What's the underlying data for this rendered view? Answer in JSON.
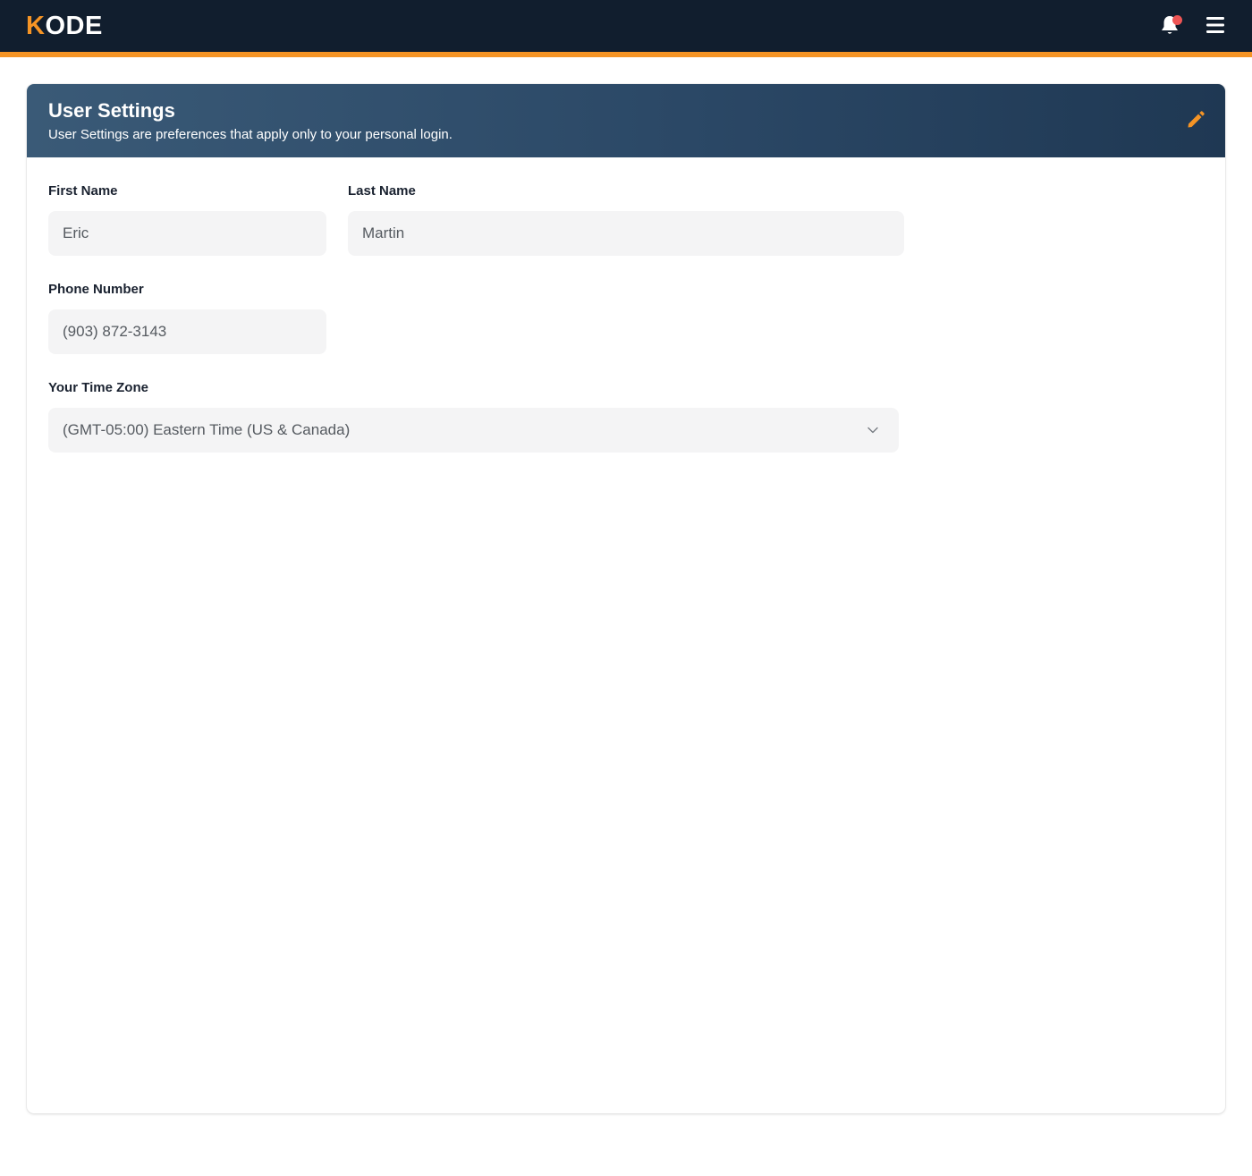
{
  "app": {
    "logo_first": "K",
    "logo_rest": "ODE",
    "brand_color": "#f59425",
    "topbar_color": "#111e2e",
    "notification_dot_color": "#ee5555",
    "icons": [
      "bell-icon",
      "hamburger-menu-icon",
      "pencil-icon",
      "chevron-down-icon"
    ]
  },
  "header": {
    "title": "User Settings",
    "subtitle": "User Settings are preferences that apply only to your personal login."
  },
  "form": {
    "first_name": {
      "label": "First Name",
      "value": "Eric"
    },
    "last_name": {
      "label": "Last Name",
      "value": "Martin"
    },
    "phone": {
      "label": "Phone Number",
      "value": "(903) 872-3143"
    },
    "timezone": {
      "label": "Your Time Zone",
      "value": "(GMT-05:00) Eastern Time (US & Canada)"
    }
  }
}
